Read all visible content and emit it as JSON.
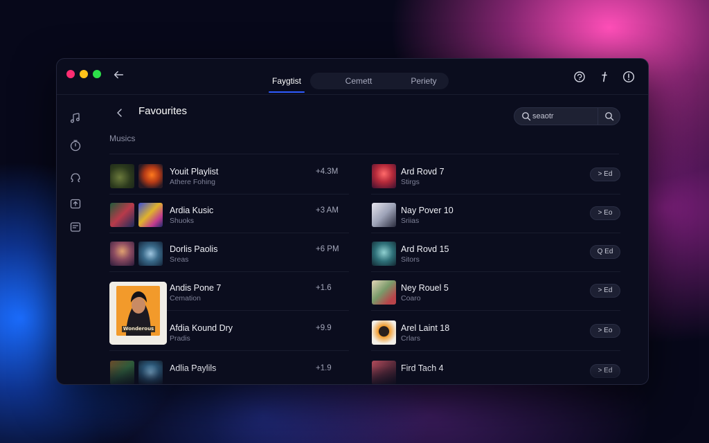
{
  "header": {
    "tabs": [
      {
        "label": "Faygtist",
        "active": true
      },
      {
        "label": "Cemett",
        "active": false
      },
      {
        "label": "Periety",
        "active": false
      }
    ],
    "icons": [
      "back-arrow-icon",
      "refresh-icon",
      "info-icon",
      "more-icon"
    ]
  },
  "sidebar": {
    "icons": [
      "music-note-icon",
      "timer-icon",
      "headphones-icon",
      "upload-icon",
      "playlist-icon"
    ]
  },
  "page": {
    "title": "Favourites",
    "section_label": "Musics"
  },
  "search": {
    "placeholder": "seaotr"
  },
  "left_list": [
    {
      "title": "Youit Playlist",
      "subtitle": "Athere Fohing",
      "meta": "+4.3M"
    },
    {
      "title": "Ardia Kusic",
      "subtitle": "Shuoks",
      "meta": "+3 AM"
    },
    {
      "title": "Dorlis Paolis",
      "subtitle": "Sreas",
      "meta": "+6 PM"
    },
    {
      "title": "Andis Pone 7",
      "subtitle": "Cemation",
      "meta": "+1.6"
    },
    {
      "title": "Afdia Kound Dry",
      "subtitle": "Pradis",
      "meta": "+9.9"
    },
    {
      "title": "Adlia Paylils",
      "subtitle": "",
      "meta": "+1.9"
    }
  ],
  "right_list": [
    {
      "title": "Ard Rovd 7",
      "subtitle": "Stirgs",
      "button": "> Ed"
    },
    {
      "title": "Nay Pover 10",
      "subtitle": "Sriias",
      "button": "> Eo"
    },
    {
      "title": "Ard Rovd 15",
      "subtitle": "Sitors",
      "button": "Q Ed"
    },
    {
      "title": "Ney Rouel 5",
      "subtitle": "Coaro",
      "button": "> Ed"
    },
    {
      "title": "Arel Laint 18",
      "subtitle": "Crlars",
      "button": "> Eo"
    },
    {
      "title": "Fird Tach 4",
      "subtitle": "",
      "button": "> Ed"
    }
  ],
  "cover_text": "Wonderous",
  "colors": {
    "accent": "#2f5bff",
    "window_bg": "#0b0d1e",
    "traffic_red": "#ff2d72",
    "traffic_yellow": "#ffc21a",
    "traffic_green": "#2de04a"
  }
}
